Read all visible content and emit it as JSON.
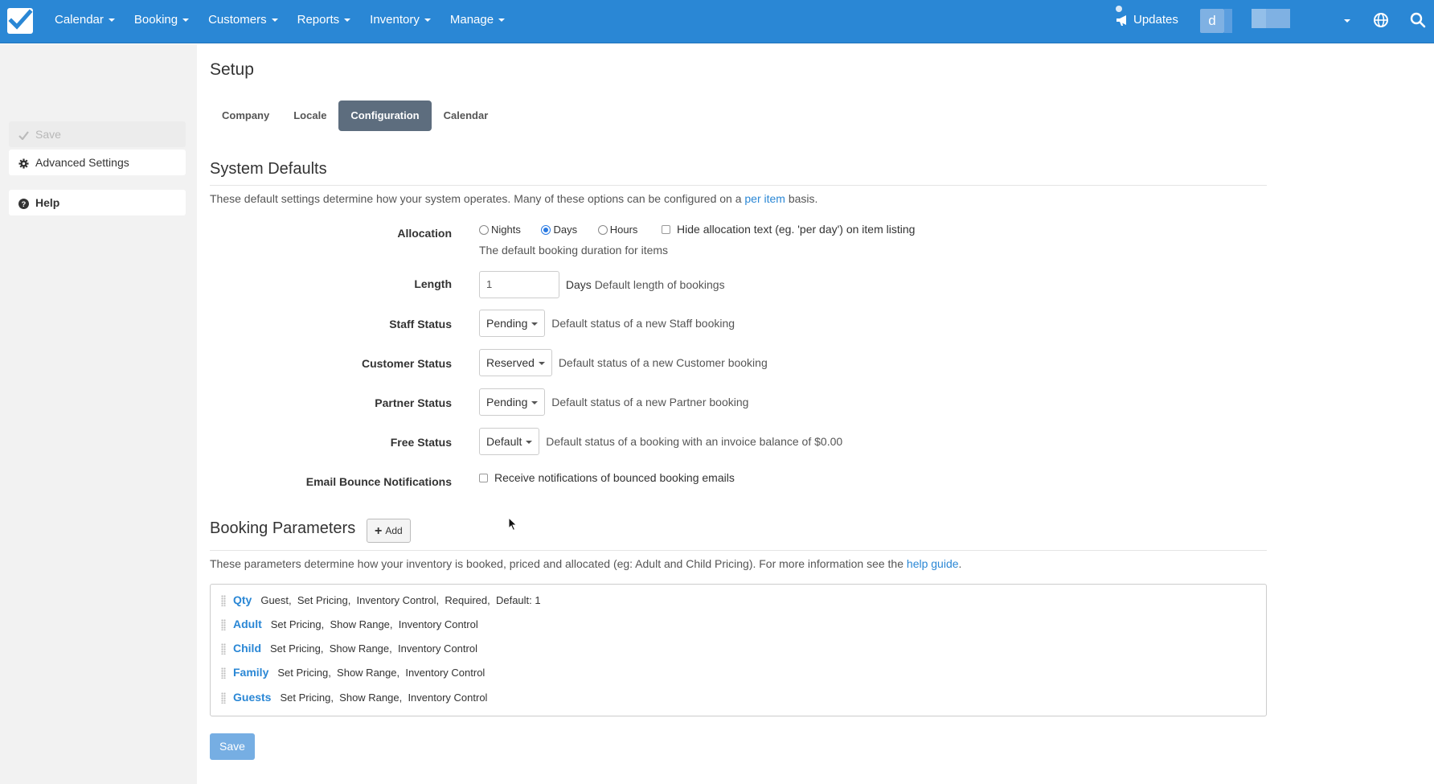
{
  "nav": {
    "items": [
      {
        "label": "Calendar"
      },
      {
        "label": "Booking"
      },
      {
        "label": "Customers"
      },
      {
        "label": "Reports"
      },
      {
        "label": "Inventory"
      },
      {
        "label": "Manage"
      }
    ],
    "updates_label": "Updates",
    "avatar_letter": "d"
  },
  "sidebar": {
    "save_label": "Save",
    "advanced_label": "Advanced Settings",
    "help_label": "Help"
  },
  "page": {
    "title": "Setup",
    "tabs": [
      {
        "label": "Company"
      },
      {
        "label": "Locale"
      },
      {
        "label": "Configuration",
        "active": true
      },
      {
        "label": "Calendar"
      }
    ]
  },
  "system_defaults": {
    "title": "System Defaults",
    "desc_before": "These default settings determine how your system operates. Many of these options can be configured on a ",
    "desc_link": "per item",
    "desc_after": " basis.",
    "allocation": {
      "label": "Allocation",
      "options": [
        "Nights",
        "Days",
        "Hours"
      ],
      "selected": "Days",
      "hide_text_label": "Hide allocation text (eg. 'per day') on item listing",
      "help": "The default booking duration for items"
    },
    "length": {
      "label": "Length",
      "value": "1",
      "unit": "Days",
      "help": "Default length of bookings"
    },
    "staff_status": {
      "label": "Staff Status",
      "value": "Pending",
      "help": "Default status of a new Staff booking"
    },
    "customer_status": {
      "label": "Customer Status",
      "value": "Reserved",
      "help": "Default status of a new Customer booking"
    },
    "partner_status": {
      "label": "Partner Status",
      "value": "Pending",
      "help": "Default status of a new Partner booking"
    },
    "free_status": {
      "label": "Free Status",
      "value": "Default",
      "help": "Default status of a booking with an invoice balance of $0.00"
    },
    "email_bounce": {
      "label": "Email Bounce Notifications",
      "checkbox_label": "Receive notifications of bounced booking emails"
    }
  },
  "booking_parameters": {
    "title": "Booking Parameters",
    "add_label": "Add",
    "desc_before": "These parameters determine how your inventory is booked, priced and allocated (eg: Adult and Child Pricing). For more information see the ",
    "desc_link": "help guide",
    "desc_after": ".",
    "items": [
      {
        "name": "Qty",
        "attrs": "Guest,  Set Pricing,  Inventory Control,  Required,  Default: 1"
      },
      {
        "name": "Adult",
        "attrs": "Set Pricing,  Show Range,  Inventory Control"
      },
      {
        "name": "Child",
        "attrs": "Set Pricing,  Show Range,  Inventory Control"
      },
      {
        "name": "Family",
        "attrs": "Set Pricing,  Show Range,  Inventory Control"
      },
      {
        "name": "Guests",
        "attrs": "Set Pricing,  Show Range,  Inventory Control"
      }
    ]
  },
  "footer": {
    "save_label": "Save"
  }
}
